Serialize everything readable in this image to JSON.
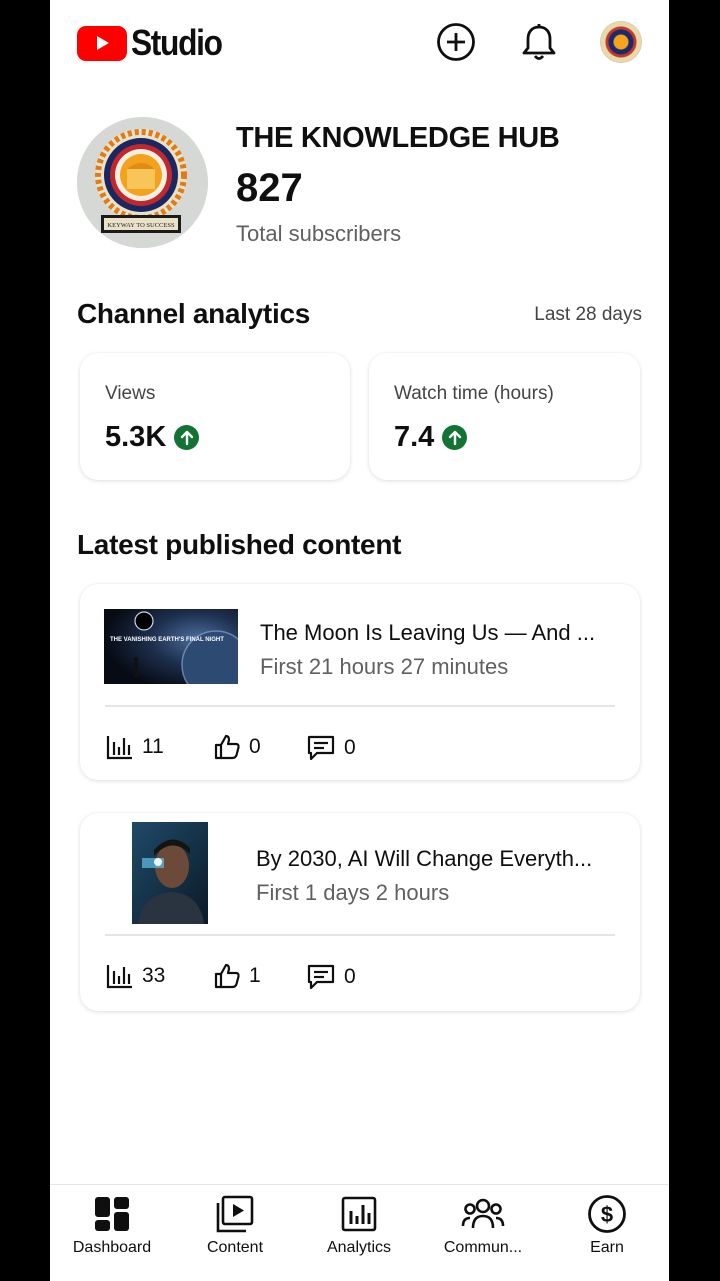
{
  "header": {
    "logo_text": "Studio"
  },
  "channel": {
    "name": "THE KNOWLEDGE HUB",
    "subscribers": "827",
    "subscribers_label": "Total subscribers",
    "avatar_text": "KEYWAY TO SUCCESS"
  },
  "analytics": {
    "title": "Channel analytics",
    "range": "Last 28 days",
    "stats": [
      {
        "label": "Views",
        "value": "5.3K",
        "trend": "up"
      },
      {
        "label": "Watch time (hours)",
        "value": "7.4",
        "trend": "up"
      }
    ]
  },
  "latest": {
    "title": "Latest published content",
    "items": [
      {
        "title": "The Moon Is Leaving Us — And ...",
        "meta": "First 21 hours 27 minutes",
        "thumb_text": "THE VANISHING EARTH'S FINAL NIGHT",
        "views": "11",
        "likes": "0",
        "comments": "0"
      },
      {
        "title": "By 2030, AI Will Change Everyth...",
        "meta": "First 1 days 2 hours",
        "views": "33",
        "likes": "1",
        "comments": "0"
      }
    ]
  },
  "nav": {
    "items": [
      {
        "label": "Dashboard",
        "icon": "dashboard-icon"
      },
      {
        "label": "Content",
        "icon": "content-icon"
      },
      {
        "label": "Analytics",
        "icon": "analytics-icon"
      },
      {
        "label": "Commun...",
        "icon": "community-icon"
      },
      {
        "label": "Earn",
        "icon": "earn-icon"
      }
    ]
  },
  "colors": {
    "brand_red": "#ff0000",
    "trend_green": "#137333"
  }
}
